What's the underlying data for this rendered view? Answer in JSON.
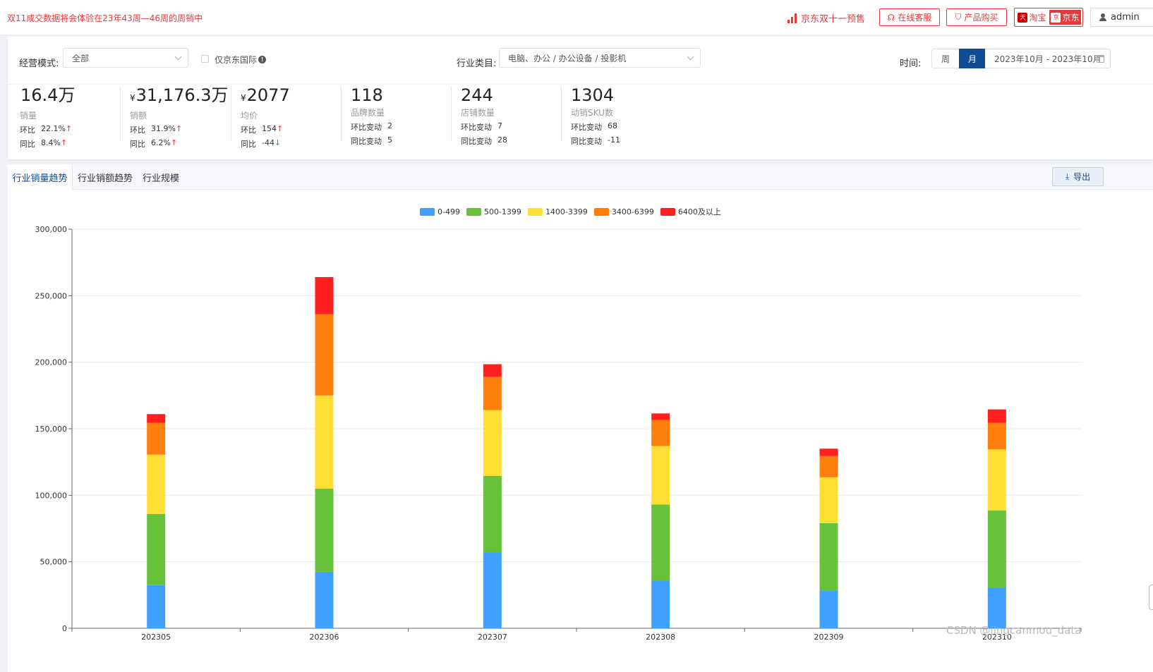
{
  "topbar": {
    "notice": "双11成交数据将会体验在23年43周—46周的周销中",
    "jd_presale": "京东双十一预售",
    "service_btn": "在线客服",
    "buy_btn": "产品购买",
    "taobao": "淘宝",
    "jd": "京东",
    "user": "admin",
    "accent": "#e4393c"
  },
  "filters": {
    "mode_label": "经营模式:",
    "mode_value": "全部",
    "jd_intl": "仅京东国际",
    "category_label": "行业类目:",
    "category_value": "电脑、办公 / 办公设备 / 投影机",
    "time_label": "时间:",
    "week": "周",
    "month": "月",
    "date_range": "2023年10月 - 2023年10月"
  },
  "stats": [
    {
      "value": "16.4万",
      "currency": "",
      "label": "销量",
      "r1_label": "环比",
      "r1_value": "22.1%",
      "r1_dir": "↑",
      "r2_label": "同比",
      "r2_value": "8.4%",
      "r2_dir": "↑"
    },
    {
      "value": "31,176.3万",
      "currency": "¥",
      "label": "销额",
      "r1_label": "环比",
      "r1_value": "31.9%",
      "r1_dir": "↑",
      "r2_label": "同比",
      "r2_value": "6.2%",
      "r2_dir": "↑"
    },
    {
      "value": "2077",
      "currency": "¥",
      "label": "均价",
      "r1_label": "环比",
      "r1_value": "154",
      "r1_dir": "↑",
      "r2_label": "同比",
      "r2_value": "-44",
      "r2_dir": "↓"
    },
    {
      "value": "118",
      "currency": "",
      "label": "品牌数量",
      "r1_label": "环比变动",
      "r1_value": "2",
      "r1_dir": "",
      "r2_label": "同比变动",
      "r2_value": "5",
      "r2_dir": ""
    },
    {
      "value": "244",
      "currency": "",
      "label": "店铺数量",
      "r1_label": "环比变动",
      "r1_value": "7",
      "r1_dir": "",
      "r2_label": "同比变动",
      "r2_value": "28",
      "r2_dir": ""
    },
    {
      "value": "1304",
      "currency": "",
      "label": "动销SKU数",
      "r1_label": "环比变动",
      "r1_value": "68",
      "r1_dir": "",
      "r2_label": "同比变动",
      "r2_value": "-11",
      "r2_dir": ""
    }
  ],
  "tabs": {
    "t1": "行业销量趋势",
    "t2": "行业销额趋势",
    "t3": "行业规模",
    "export": "导出"
  },
  "watermark": "CSDN @jingcanmou_data",
  "chart_data": {
    "type": "bar",
    "stacked": true,
    "categories": [
      "202305",
      "202306",
      "202307",
      "202308",
      "202309",
      "202310"
    ],
    "series": [
      {
        "name": "0-499",
        "color": "#3fa0ff",
        "values": [
          32500,
          42500,
          57000,
          36000,
          28500,
          30500
        ]
      },
      {
        "name": "500-1399",
        "color": "#67c23a",
        "values": [
          53500,
          62500,
          57500,
          57000,
          50500,
          58000
        ]
      },
      {
        "name": "1400-3399",
        "color": "#ffdf33",
        "values": [
          44500,
          70000,
          49500,
          44000,
          34500,
          46000
        ]
      },
      {
        "name": "3400-6399",
        "color": "#ff7f0e",
        "values": [
          24000,
          61000,
          25000,
          19500,
          16000,
          20000
        ]
      },
      {
        "name": "6400及以上",
        "color": "#ff1f1f",
        "values": [
          6500,
          28000,
          9500,
          5000,
          5500,
          10000
        ]
      }
    ],
    "ylim": [
      0,
      300000
    ],
    "yticks": [
      "0",
      "50,000",
      "100,000",
      "150,000",
      "200,000",
      "250,000",
      "300,000"
    ],
    "grid": true,
    "legend": "top-center"
  }
}
